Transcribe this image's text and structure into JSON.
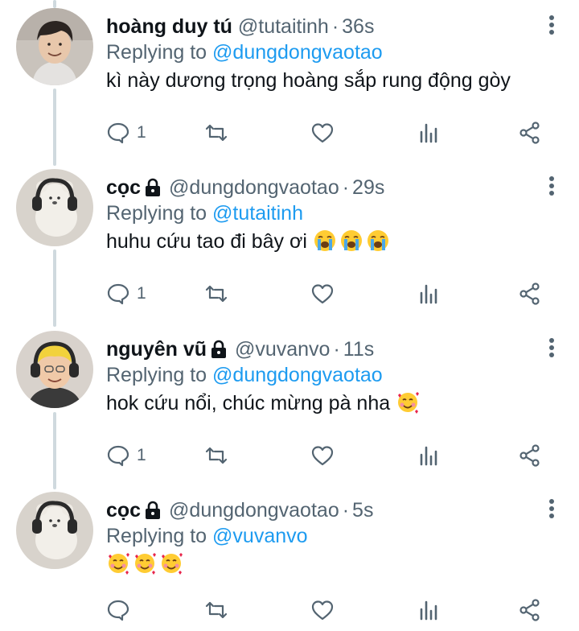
{
  "colors": {
    "text": "#0f1419",
    "muted": "#536471",
    "link": "#1d9bf0",
    "line": "#cfd9de"
  },
  "tweets": [
    {
      "name": "hoàng duy tú",
      "handle": "@tutaitinh",
      "dot": "·",
      "time": "36s",
      "replying_prefix": "Replying to",
      "replying_to": "@dungdongvaotao",
      "text": "kì này dương trọng hoàng sắp rung động gòy",
      "emojis": [],
      "locked": false,
      "avatar": "avatar-boy-smiling",
      "reply_count": "1"
    },
    {
      "name": "cọc",
      "handle": "@dungdongvaotao",
      "dot": "·",
      "time": "29s",
      "replying_prefix": "Replying to",
      "replying_to": "@tutaitinh",
      "text": "huhu cứu tao đi bây ơi",
      "emojis": [
        "loudly-crying-face",
        "loudly-crying-face",
        "loudly-crying-face"
      ],
      "locked": true,
      "avatar": "avatar-teddy-bear-headphones",
      "reply_count": "1"
    },
    {
      "name": "nguyên vũ",
      "handle": "@vuvanvo",
      "dot": "·",
      "time": "11s",
      "replying_prefix": "Replying to",
      "replying_to": "@dungdongvaotao",
      "text": "hok cứu nổi, chúc mừng pà nha",
      "emojis": [
        "smiling-face-with-hearts"
      ],
      "locked": true,
      "avatar": "avatar-boy-headset",
      "reply_count": "1"
    },
    {
      "name": "cọc",
      "handle": "@dungdongvaotao",
      "dot": "·",
      "time": "5s",
      "replying_prefix": "Replying to",
      "replying_to": "@vuvanvo",
      "text": "",
      "emojis": [
        "smiling-face-with-hearts",
        "smiling-face-with-hearts",
        "smiling-face-with-hearts"
      ],
      "locked": true,
      "avatar": "avatar-teddy-bear-headphones",
      "reply_count": ""
    }
  ]
}
